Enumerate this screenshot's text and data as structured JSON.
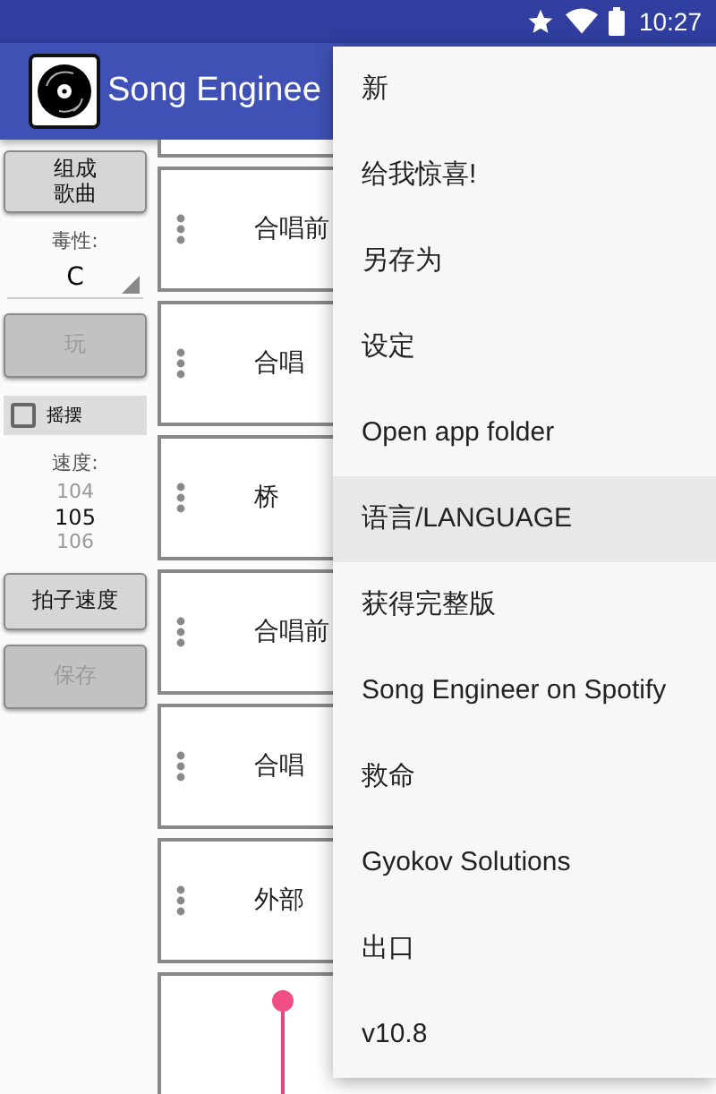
{
  "status_bar": {
    "time": "10:27"
  },
  "app_bar": {
    "title": "Song Enginee"
  },
  "sidebar": {
    "compose_button": {
      "label": "组成歌曲",
      "disabled": false
    },
    "key_label": "毒性:",
    "key_value": "C",
    "play_button": {
      "label": "玩",
      "disabled": true
    },
    "swing": {
      "label": "摇摆",
      "checked": false
    },
    "tempo_label": "速度:",
    "tempo_values": [
      {
        "value": "104",
        "selected": false
      },
      {
        "value": "105",
        "selected": true
      },
      {
        "value": "106",
        "selected": false
      }
    ],
    "tap_tempo_button": {
      "label": "拍子速度",
      "disabled": false
    },
    "save_button": {
      "label": "保存",
      "disabled": true
    }
  },
  "sections": [
    {
      "label": "合唱前"
    },
    {
      "label": "合唱"
    },
    {
      "label": "桥"
    },
    {
      "label": "合唱前"
    },
    {
      "label": "合唱"
    },
    {
      "label": "外部"
    }
  ],
  "menu": [
    {
      "label": "新",
      "highlighted": false
    },
    {
      "label": "给我惊喜!",
      "highlighted": false
    },
    {
      "label": "另存为",
      "highlighted": false
    },
    {
      "label": "设定",
      "highlighted": false
    },
    {
      "label": "Open app folder",
      "highlighted": false
    },
    {
      "label": "语言/LANGUAGE",
      "highlighted": true
    },
    {
      "label": "获得完整版",
      "highlighted": false
    },
    {
      "label": "Song Engineer on Spotify",
      "highlighted": false
    },
    {
      "label": "救命",
      "highlighted": false
    },
    {
      "label": "Gyokov Solutions",
      "highlighted": false
    },
    {
      "label": "出口",
      "highlighted": false
    },
    {
      "label": "v10.8",
      "highlighted": false
    }
  ]
}
